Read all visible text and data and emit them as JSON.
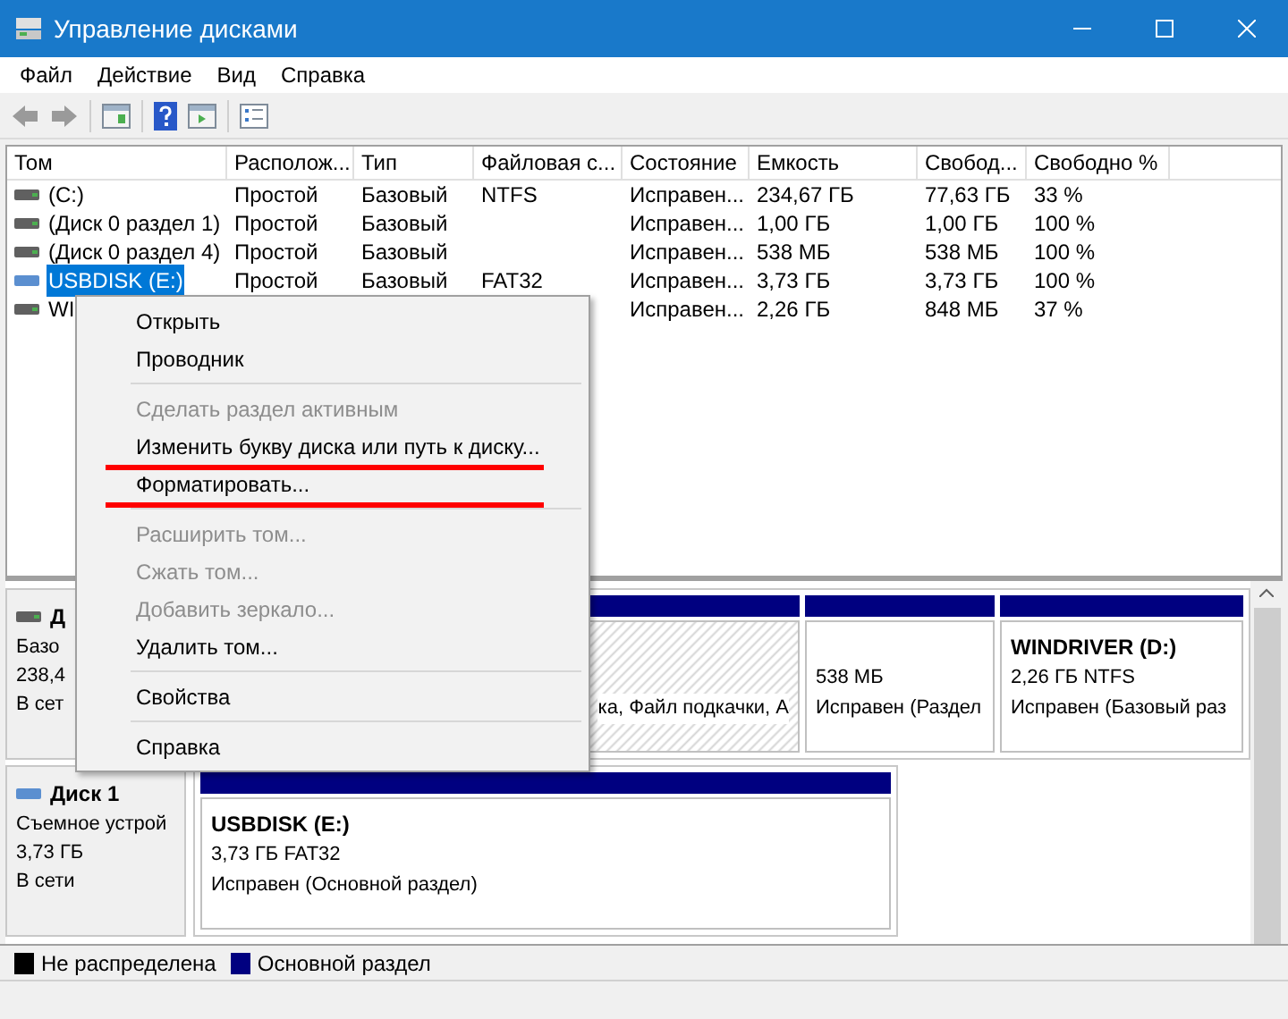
{
  "window": {
    "title": "Управление дисками"
  },
  "menu": [
    "Файл",
    "Действие",
    "Вид",
    "Справка"
  ],
  "volumes": {
    "columns": [
      "Том",
      "Располож...",
      "Тип",
      "Файловая с...",
      "Состояние",
      "Емкость",
      "Свобод...",
      "Свободно %"
    ],
    "rows": [
      {
        "cells": [
          "(C:)",
          "Простой",
          "Базовый",
          "NTFS",
          "Исправен...",
          "234,67 ГБ",
          "77,63 ГБ",
          "33 %"
        ],
        "selected": false,
        "kind": "hdd"
      },
      {
        "cells": [
          "(Диск 0 раздел 1)",
          "Простой",
          "Базовый",
          "",
          "Исправен...",
          "1,00 ГБ",
          "1,00 ГБ",
          "100 %"
        ],
        "selected": false,
        "kind": "hdd"
      },
      {
        "cells": [
          "(Диск 0 раздел 4)",
          "Простой",
          "Базовый",
          "",
          "Исправен...",
          "538 МБ",
          "538 МБ",
          "100 %"
        ],
        "selected": false,
        "kind": "hdd"
      },
      {
        "cells": [
          "USBDISK (E:)",
          "Простой",
          "Базовый",
          "FAT32",
          "Исправен...",
          "3,73 ГБ",
          "3,73 ГБ",
          "100 %"
        ],
        "selected": true,
        "kind": "usb"
      },
      {
        "cells": [
          "WI",
          "",
          "",
          "",
          "Исправен...",
          "2,26 ГБ",
          "848 МБ",
          "37 %"
        ],
        "selected": false,
        "kind": "hdd"
      }
    ]
  },
  "context_menu": [
    {
      "kind": "item",
      "label": "Открыть",
      "disabled": false,
      "underlined": false
    },
    {
      "kind": "item",
      "label": "Проводник",
      "disabled": false,
      "underlined": false
    },
    {
      "kind": "separator"
    },
    {
      "kind": "item",
      "label": "Сделать раздел активным",
      "disabled": true,
      "underlined": false
    },
    {
      "kind": "item",
      "label": "Изменить букву диска или путь к диску...",
      "disabled": false,
      "underlined": true
    },
    {
      "kind": "item",
      "label": "Форматировать...",
      "disabled": false,
      "underlined": true
    },
    {
      "kind": "separator"
    },
    {
      "kind": "item",
      "label": "Расширить том...",
      "disabled": true,
      "underlined": false
    },
    {
      "kind": "item",
      "label": "Сжать том...",
      "disabled": true,
      "underlined": false
    },
    {
      "kind": "item",
      "label": "Добавить зеркало...",
      "disabled": true,
      "underlined": false
    },
    {
      "kind": "item",
      "label": "Удалить том...",
      "disabled": false,
      "underlined": false
    },
    {
      "kind": "separator"
    },
    {
      "kind": "item",
      "label": "Свойства",
      "disabled": false,
      "underlined": false
    },
    {
      "kind": "separator"
    },
    {
      "kind": "item",
      "label": "Справка",
      "disabled": false,
      "underlined": false
    }
  ],
  "disks": [
    {
      "name": "Д",
      "lines": [
        "Базо",
        "238,4",
        "В сет"
      ],
      "kind": "hdd",
      "partitions": [
        {
          "lines": [
            "ка, Файл подкачки, А"
          ],
          "hatched": true
        },
        {
          "lines": [
            "538 МБ",
            "Исправен (Раздел"
          ],
          "hatched": false
        },
        {
          "title": "WINDRIVER  (D:)",
          "lines": [
            "2,26 ГБ NTFS",
            "Исправен (Базовый раз"
          ],
          "hatched": false
        }
      ]
    },
    {
      "name": "Диск 1",
      "lines": [
        "Съемное устрой",
        "3,73 ГБ",
        "В сети"
      ],
      "kind": "usb",
      "partitions": [
        {
          "title": "USBDISK  (E:)",
          "lines": [
            "3,73 ГБ FAT32",
            "Исправен (Основной раздел)"
          ],
          "hatched": false
        }
      ]
    }
  ],
  "legend": [
    {
      "label": "Не распределена",
      "color": "#000000"
    },
    {
      "label": "Основной раздел",
      "color": "#000080"
    }
  ]
}
